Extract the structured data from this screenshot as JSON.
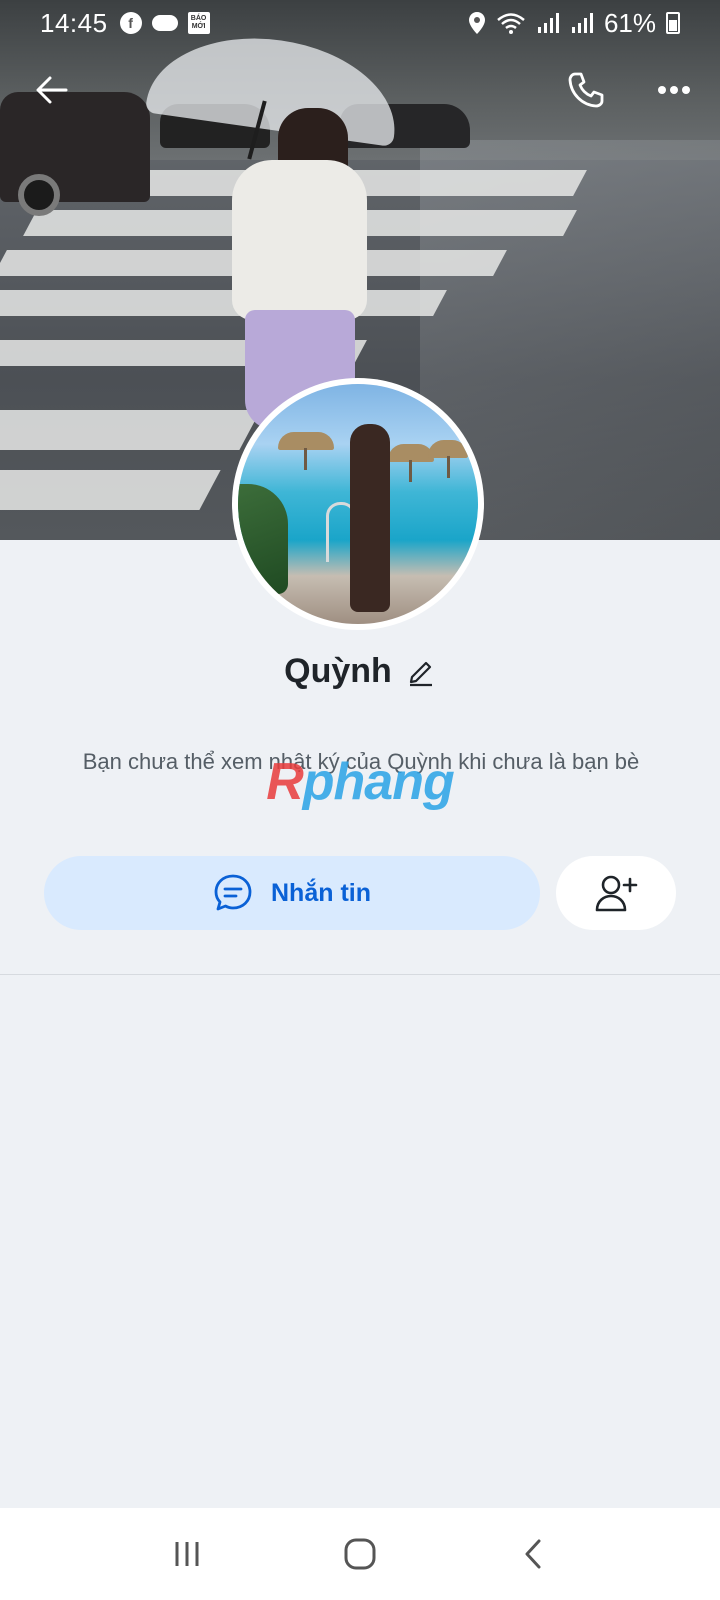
{
  "status_bar": {
    "time": "14:45",
    "notification_icons": [
      "facebook-icon",
      "cloud-icon",
      "baomoi-icon"
    ],
    "baomoi_text": "BÁO MỚI",
    "battery": "61%"
  },
  "header": {
    "back_icon": "arrow-left-icon",
    "call_icon": "phone-icon",
    "more_icon": "more-dots-icon"
  },
  "profile": {
    "name": "Quỳnh",
    "notice": "Bạn chưa thể xem nhật ký của Quỳnh khi chưa là bạn bè"
  },
  "watermark": {
    "part1": "R",
    "part2": "phang"
  },
  "actions": {
    "message_label": "Nhắn tin",
    "message_icon": "chat-bubble-icon",
    "add_friend_icon": "add-friend-icon"
  },
  "colors": {
    "accent": "#0a61d6",
    "message_button_bg": "#d9eafe",
    "background": "#eef1f5"
  },
  "navbar": {
    "items": [
      "recent-apps-icon",
      "home-icon",
      "back-icon"
    ]
  }
}
